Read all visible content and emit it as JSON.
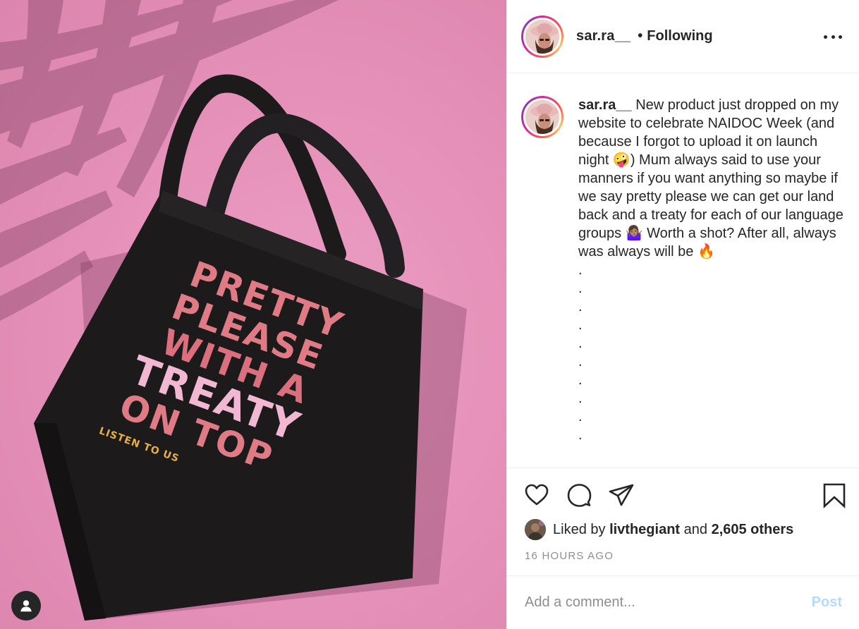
{
  "post": {
    "username": "sar.ra__",
    "separator": "•",
    "follow_status": "Following",
    "image_text": {
      "line1": "PRETTY",
      "line2": "PLEASE",
      "line3": "WITH A",
      "line4": "TREATY",
      "line5": "ON TOP",
      "tagline": "LISTEN TO US"
    }
  },
  "caption": {
    "username": "sar.ra__",
    "text": " New product just dropped on my website to celebrate NAIDOC Week (and because I forgot to upload it on launch night 🤪) Mum always said to use your manners if you want anything so maybe if we say pretty please we can get our land back and a treaty for each of our language groups 🤷🏽‍♀️ Worth a shot? After all, always was always will be 🔥",
    "dots": [
      ".",
      ".",
      ".",
      ".",
      ".",
      ".",
      ".",
      ".",
      ".",
      "."
    ]
  },
  "likes": {
    "prefix": "Liked by ",
    "user": "livthegiant",
    "middle": " and ",
    "others": "2,605 others"
  },
  "timestamp": "16 HOURS AGO",
  "comment": {
    "placeholder": "Add a comment...",
    "post_label": "Post"
  },
  "icons": {
    "like": "heart-icon",
    "comment": "comment-icon",
    "share": "paper-plane-icon",
    "save": "bookmark-icon",
    "more": "more-icon",
    "tag": "user-icon"
  },
  "colors": {
    "background_pink": "#e692ba",
    "bag_black": "#1c1a1b",
    "text_salmon": "#e07b86",
    "text_light_pink": "#f2b8d3",
    "tagline_yellow": "#e8b040",
    "post_button_disabled": "#b3dbff",
    "meta_gray": "#8e8e8e"
  }
}
